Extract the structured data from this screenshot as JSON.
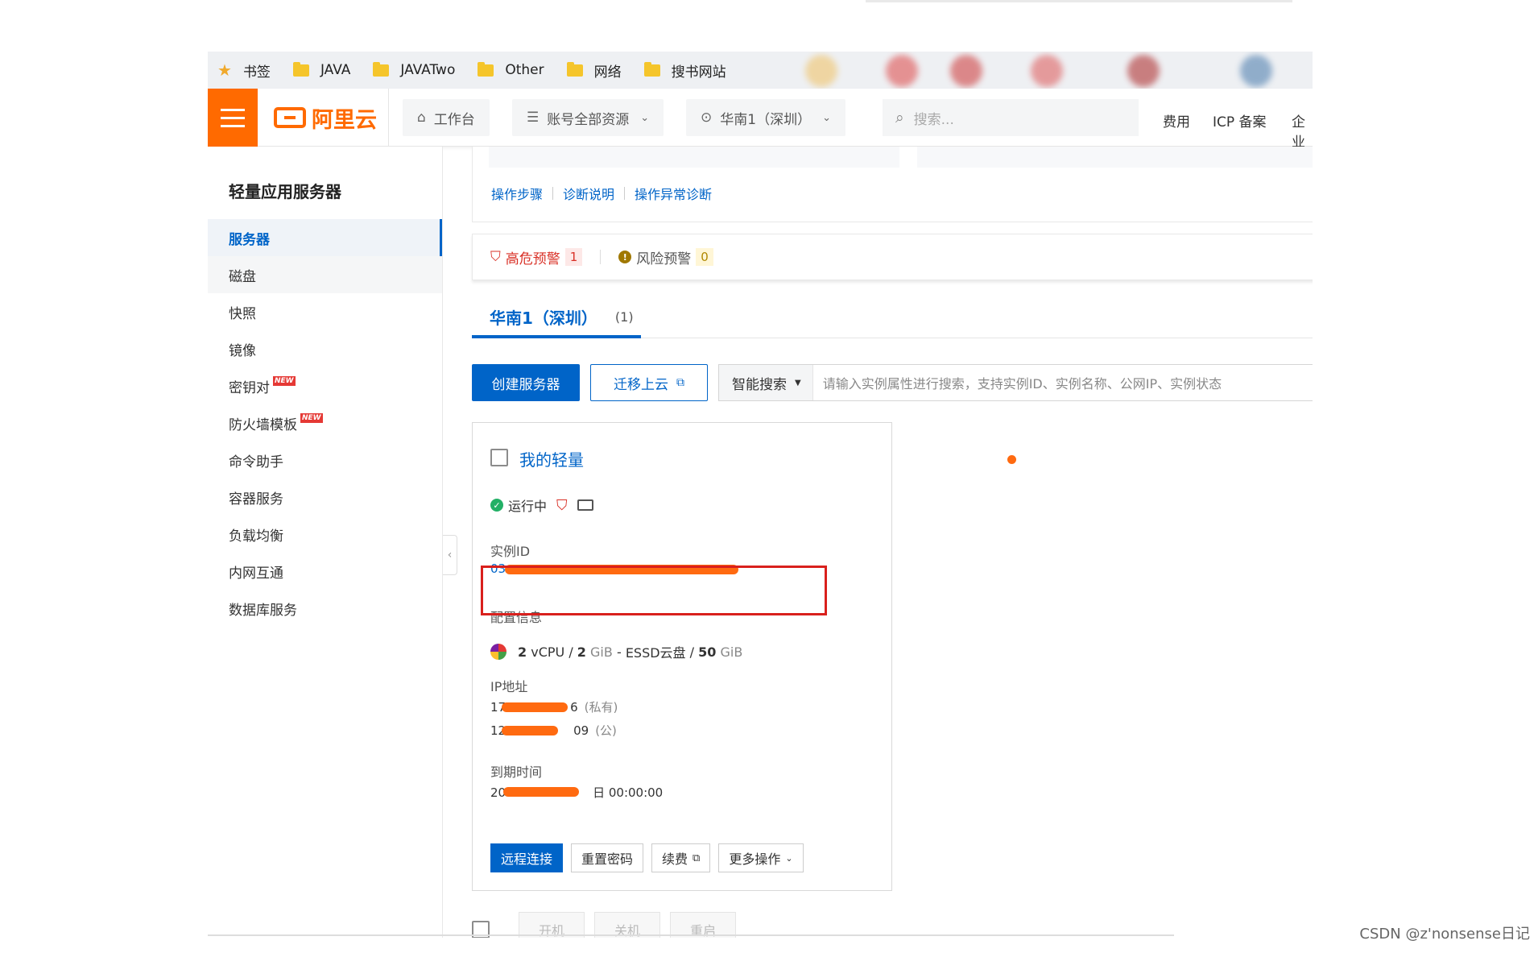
{
  "bookmarks": [
    {
      "label": "书签",
      "icon": "star-icon"
    },
    {
      "label": "JAVA",
      "icon": "folder-icon"
    },
    {
      "label": "JAVATwo",
      "icon": "folder-icon"
    },
    {
      "label": "Other",
      "icon": "folder-icon"
    },
    {
      "label": "网络",
      "icon": "folder-icon"
    },
    {
      "label": "搜书网站",
      "icon": "folder-icon"
    }
  ],
  "header": {
    "logo": "阿里云",
    "workbench": "工作台",
    "resources": "账号全部资源",
    "region": "华南1（深圳）",
    "search_placeholder": "搜索...",
    "links": [
      "费用",
      "ICP 备案",
      "企业"
    ]
  },
  "sidebar": {
    "title": "轻量应用服务器",
    "items": [
      {
        "label": "服务器",
        "new": false
      },
      {
        "label": "磁盘",
        "new": false
      },
      {
        "label": "快照",
        "new": false
      },
      {
        "label": "镜像",
        "new": false
      },
      {
        "label": "密钥对",
        "new": true
      },
      {
        "label": "防火墙模板",
        "new": true
      },
      {
        "label": "命令助手",
        "new": false
      },
      {
        "label": "容器服务",
        "new": false
      },
      {
        "label": "负载均衡",
        "new": false
      },
      {
        "label": "内网互通",
        "new": false
      },
      {
        "label": "数据库服务",
        "new": false
      }
    ],
    "new_tag": "NEW"
  },
  "help_links": [
    "操作步骤",
    "诊断说明",
    "操作异常诊断"
  ],
  "alerts": {
    "high_label": "高危预警",
    "high_count": "1",
    "risk_label": "风险预警",
    "risk_count": "0"
  },
  "region_tab": {
    "label": "华南1（深圳）",
    "count": "(1)"
  },
  "toolbar": {
    "create": "创建服务器",
    "migrate": "迁移上云",
    "smart_search": "智能搜索",
    "search_placeholder": "请输入实例属性进行搜索，支持实例ID、实例名称、公网IP、实例状态"
  },
  "instance": {
    "name": "我的轻量",
    "status": "运行中",
    "id_label": "实例ID",
    "id_value": "03",
    "config_label": "配置信息",
    "config": {
      "cpu": "2",
      "cpu_unit": "vCPU",
      "mem": "2",
      "mem_unit": "GiB",
      "disk_type": "ESSD云盘",
      "disk": "50",
      "disk_unit": "GiB"
    },
    "ip_label": "IP地址",
    "ip_private_prefix": "17",
    "ip_private_suffix": "6",
    "ip_private_tag": "(私有)",
    "ip_public_prefix": "12",
    "ip_public_suffix": "09",
    "ip_public_tag": "(公)",
    "expire_label": "到期时间",
    "expire_prefix": "20",
    "expire_suffix": "日 00:00:00",
    "actions": [
      "远程连接",
      "重置密码",
      "续费",
      "更多操作"
    ]
  },
  "bulk_actions": [
    "开机",
    "关机",
    "重启"
  ],
  "watermark": "CSDN @z'nonsense日记",
  "colors": {
    "accent": "#0064c8",
    "brand": "#ff6a00",
    "danger": "#d93026",
    "redaction": "#ff6a10"
  }
}
